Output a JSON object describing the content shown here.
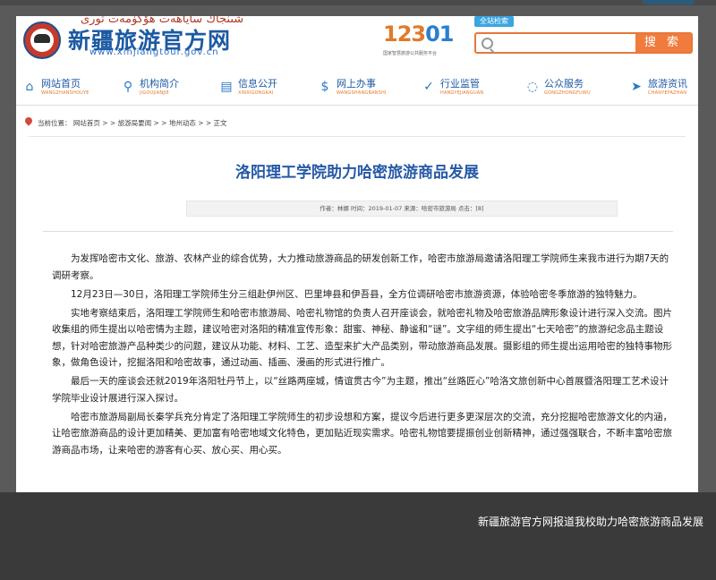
{
  "header": {
    "logo_uyghur": "شىنجاڭ ساياھەت ھۆكۈمەت تورى",
    "logo_title": "新疆旅游官方网",
    "logo_url": "www.xinjiangtour.gov.cn",
    "hotline_number_a": "123",
    "hotline_number_b": "01",
    "hotline_caption": "国家智慧旅游公共服务平台",
    "search_tab": "全站检索",
    "search_placeholder": "",
    "search_button": "搜 索"
  },
  "nav": {
    "items": [
      {
        "label": "网站首页",
        "pinyin": "WANGZHANSHOUYE",
        "icon": "home-icon"
      },
      {
        "label": "机构简介",
        "pinyin": "JIGOUJIANJIE",
        "icon": "location-pin-icon"
      },
      {
        "label": "信息公开",
        "pinyin": "XINXIGONGKAI",
        "icon": "document-icon"
      },
      {
        "label": "网上办事",
        "pinyin": "WANGSHANGBANSHI",
        "icon": "currency-icon"
      },
      {
        "label": "行业监管",
        "pinyin": "HANGYEJIANGUAN",
        "icon": "shield-check-icon"
      },
      {
        "label": "公众服务",
        "pinyin": "GONGZHONGFUWU",
        "icon": "chat-bubble-icon"
      },
      {
        "label": "旅游资讯",
        "pinyin": "CHANYEFAZHAN",
        "icon": "send-icon"
      }
    ]
  },
  "breadcrumb": {
    "text": "当前位置： 网站首页 > > 旅游局要闻 > > 地州动态 > > 正文"
  },
  "article": {
    "title": "洛阳理工学院助力哈密旅游商品发展",
    "meta": "作者：林娜  时间：2019-01-07  来源：哈密市旅游局  点击：[8]",
    "paragraphs": [
      "为发挥哈密市文化、旅游、农林产业的综合优势，大力推动旅游商品的研发创新工作，哈密市旅游局邀请洛阳理工学院师生来我市进行为期7天的调研考察。",
      "12月23日—30日，洛阳理工学院师生分三组赴伊州区、巴里坤县和伊吾县，全方位调研哈密市旅游资源，体验哈密冬季旅游的独特魅力。",
      "实地考察结束后，洛阳理工学院师生和哈密市旅游局、哈密礼物馆的负责人召开座谈会，就哈密礼物及哈密旅游品牌形象设计进行深入交流。图片收集组的师生提出以哈密情为主题，建议哈密对洛阳的精准宣传形象：甜蜜、神秘、静谧和“谜”。文字组的师生提出“七天哈密”的旅游纪念品主题设想，针对哈密旅游产品种类少的问题，建议从功能、材料、工艺、造型来扩大产品类别，带动旅游商品发展。摄影组的师生提出运用哈密的独特事物形象，做角色设计，挖掘洛阳和哈密故事，通过动画、插画、漫画的形式进行推广。",
      "最后一天的座谈会还就2019年洛阳牡丹节上，以“丝路两座城，情谊贯古今”为主题，推出“丝路匠心”哈洛文旅创新中心首展暨洛阳理工艺术设计学院毕业设计展进行深入探讨。",
      "哈密市旅游局副局长秦学兵充分肯定了洛阳理工学院师生的初步设想和方案，提议今后进行更多更深层次的交流，充分挖掘哈密旅游文化的内涵，让哈密旅游商品的设计更加精美、更加富有哈密地域文化特色，更加贴近现实需求。哈密礼物馆要提振创业创新精神，通过强强联合，不断丰富哈密旅游商品市场，让来哈密的游客有心买、放心买、用心买。"
    ]
  },
  "caption": "新疆旅游官方网报道我校助力哈密旅游商品发展"
}
